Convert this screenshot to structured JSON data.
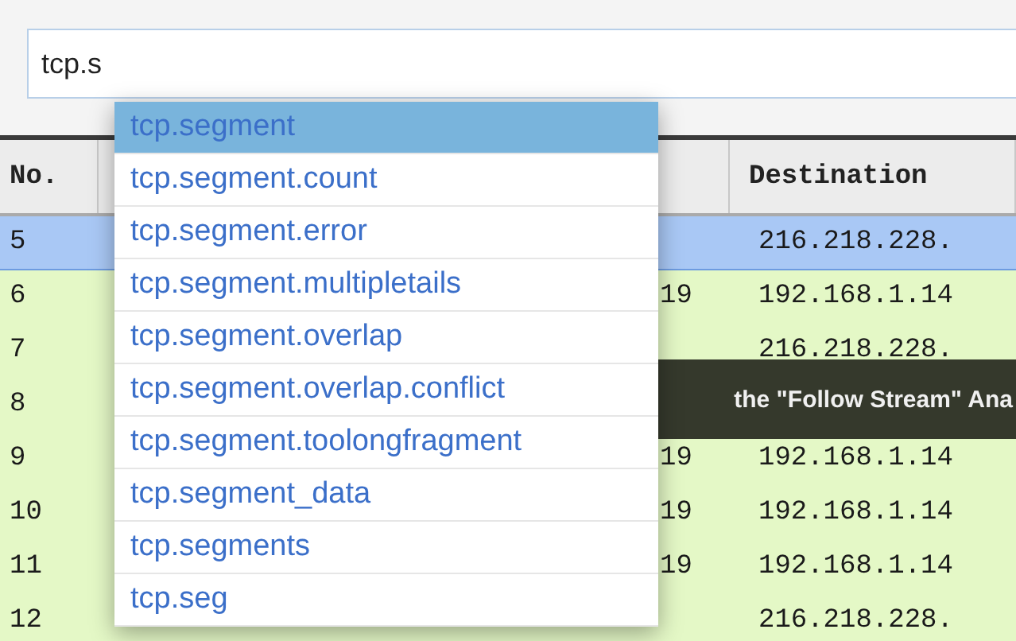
{
  "filter": {
    "value": "tcp.s"
  },
  "table": {
    "columns": [
      {
        "label": "No."
      },
      {
        "label": "Destination"
      }
    ],
    "rows": [
      {
        "no": "5",
        "destination": "216.218.228.",
        "selected": true
      },
      {
        "no": "6",
        "column_3": "19",
        "destination": "192.168.1.14",
        "selected": false
      },
      {
        "no": "7",
        "destination": "216.218.228.",
        "selected": false
      },
      {
        "no": "8",
        "selected": false
      },
      {
        "no": "9",
        "column_3": "19",
        "destination": "192.168.1.14",
        "selected": false
      },
      {
        "no": "10",
        "column_3": "19",
        "destination": "192.168.1.14",
        "selected": false
      },
      {
        "no": "11",
        "column_3": "19",
        "destination": "192.168.1.14",
        "selected": false
      },
      {
        "no": "12",
        "destination": "216.218.228.",
        "selected": false
      }
    ]
  },
  "tooltip": {
    "text": "the \"Follow Stream\" Ana"
  },
  "suggestions": [
    {
      "label": "tcp.segment",
      "selected": true
    },
    {
      "label": "tcp.segment.count",
      "selected": false
    },
    {
      "label": "tcp.segment.error",
      "selected": false
    },
    {
      "label": "tcp.segment.multipletails",
      "selected": false
    },
    {
      "label": "tcp.segment.overlap",
      "selected": false
    },
    {
      "label": "tcp.segment.overlap.conflict",
      "selected": false
    },
    {
      "label": "tcp.segment.toolongfragment",
      "selected": false
    },
    {
      "label": "tcp.segment_data",
      "selected": false
    },
    {
      "label": "tcp.segments",
      "selected": false
    },
    {
      "label": "tcp.seg",
      "selected": false
    }
  ]
}
